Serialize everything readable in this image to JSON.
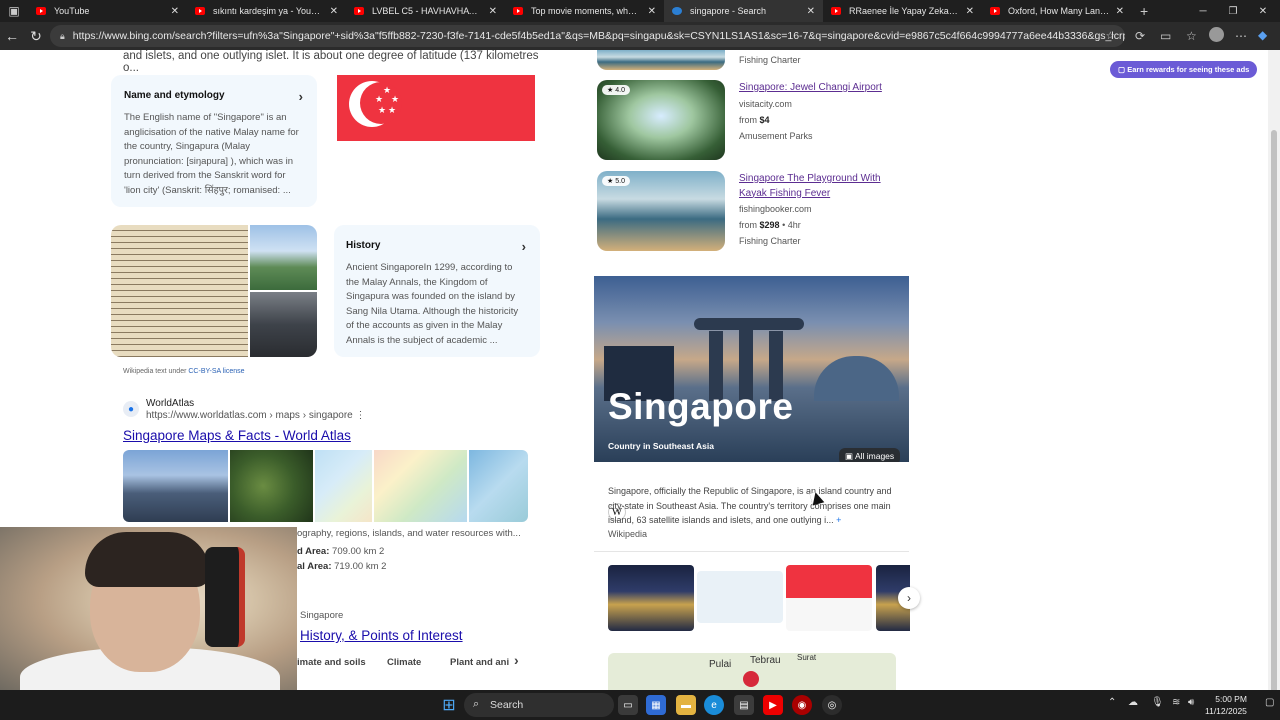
{
  "browser": {
    "tabs": [
      {
        "title": "YouTube",
        "icon": "youtube-icon",
        "active": false
      },
      {
        "title": "sıkıntı kardeşim ya - YouTube",
        "icon": "youtube-icon",
        "active": false
      },
      {
        "title": "LVBEL C5 - HAVHAVHAV (1960's Di",
        "icon": "youtube-icon",
        "active": false
      },
      {
        "title": "Top movie moments, when reinfo",
        "icon": "youtube-icon",
        "active": false
      },
      {
        "title": "singapore - Search",
        "icon": "bing-icon",
        "active": true
      },
      {
        "title": "RRaenee İle Yapay Zeka Sohbeti",
        "icon": "youtube-icon",
        "active": false
      },
      {
        "title": "Oxford, How Many Languages Do",
        "icon": "youtube-icon",
        "active": false
      }
    ],
    "url": "https://www.bing.com/search?filters=ufn%3a\"Singapore\"+sid%3a\"f5ffb882-7230-f3fe-7141-cde5f4b5ed1a\"&qs=MB&pq=singapu&sk=CSYN1LS1AS1&sc=16-7&q=singapore&cvid=e9867c5c4f664c9994777a6ee44b3336&gs_lcrp=EgRlZGdlKgYIAx..."
  },
  "left": {
    "intro": "and islets, and one outlying islet. It is about one degree of latitude (137 kilometres o...",
    "etymology": {
      "title": "Name and etymology",
      "text": "The English name of \"Singapore\" is an anglicisation of the native Malay name for the country, Singapura (Malay pronunciation: [siŋapura] ), which was in turn derived from the Sanskrit word for 'lion city' (Sanskrit: सिंहपुर; romanised: ..."
    },
    "history": {
      "title": "History",
      "text": "Ancient SingaporeIn 1299, according to the Malay Annals, the Kingdom of Singapura was founded on the island by Sang Nila Utama. Although the historicity of the accounts as given in the Malay Annals is the subject of academic ..."
    },
    "wiki_note": "Wikipedia text under",
    "wiki_license": "CC-BY-SA license",
    "worldatlas": {
      "name": "WorldAtlas",
      "url": "https://www.worldatlas.com › maps › singapore",
      "title": "Singapore Maps & Facts - World Atlas",
      "snippet": "ography, regions, islands, and water resources with...",
      "land_area": "d Area:",
      "land_value": "709.00 km 2",
      "total_area": "al Area:",
      "total_value": "719.00 km 2"
    },
    "britannica": {
      "name": "Singapore",
      "title": "History, & Points of Interest"
    },
    "pills": [
      "imate and soils",
      "Climate",
      "Plant and ani"
    ]
  },
  "right": {
    "top_category": "Fishing Charter",
    "results": [
      {
        "rating": "4.0",
        "title": "Singapore: Jewel Changi Airport",
        "site": "visitacity.com",
        "price_prefix": "from",
        "price": "$4",
        "extra": "",
        "category": "Amusement Parks"
      },
      {
        "rating": "5.0",
        "title": "Singapore The Playground With Kayak Fishing Fever",
        "site": "fishingbooker.com",
        "price_prefix": "from",
        "price": "$298",
        "extra": "• 4hr",
        "category": "Fishing Charter"
      }
    ],
    "entity": {
      "name": "Singapore",
      "subtitle": "Country in Southeast Asia",
      "all_images": "All images",
      "description": "Singapore, officially the Republic of Singapore, is an island country and city-state in Southeast Asia. The country's territory comprises one main island, 63 satellite islands and islets, and one outlying i...",
      "source": "Wikipedia"
    },
    "map_labels": [
      "Pulai",
      "Tebrau",
      "Surat"
    ]
  },
  "ads_banner": "Earn rewards for seeing these ads",
  "taskbar": {
    "search_label": "Search",
    "time": "5:00 PM",
    "date": "11/12/2025"
  }
}
